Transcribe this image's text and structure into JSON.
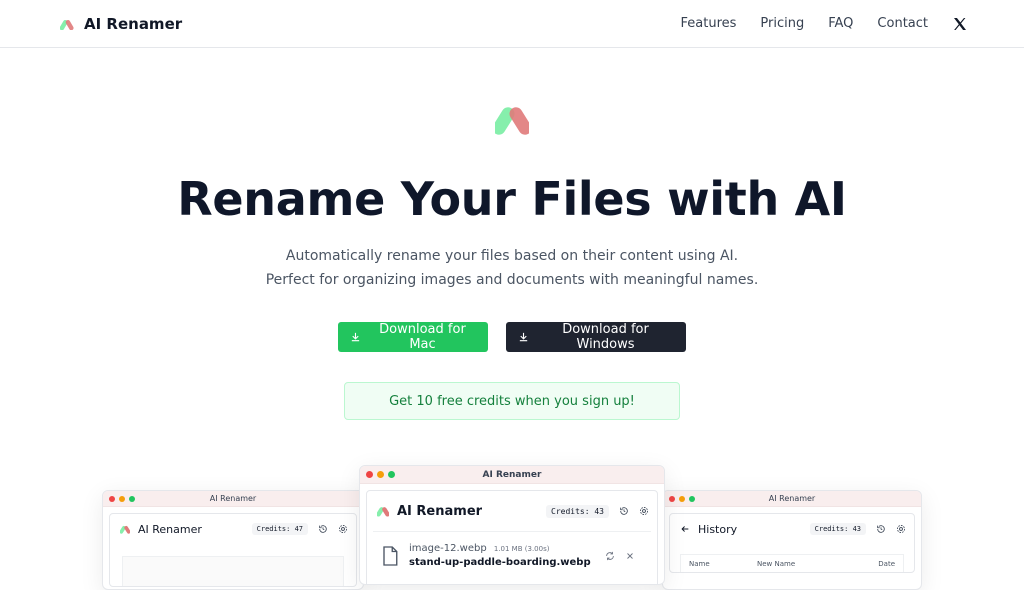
{
  "header": {
    "brand": "AI Renamer",
    "nav": [
      "Features",
      "Pricing",
      "FAQ",
      "Contact"
    ]
  },
  "hero": {
    "title": "Rename Your Files with AI",
    "subtitle": "Automatically rename your files based on their content using AI. Perfect for organizing images and documents with meaningful names.",
    "mac_button": "Download for Mac",
    "windows_button": "Download for Windows",
    "promo": "Get 10 free credits when you sign up!"
  },
  "colors": {
    "accent_green": "#22c55e",
    "dark_button": "#1f2430",
    "logo_green": "#86efac",
    "logo_red": "#e07a7a"
  },
  "icons": {
    "logo": "ai-renamer-logo-icon",
    "download": "download-icon",
    "history": "history-icon",
    "settings": "gear-icon",
    "file": "file-icon",
    "retry": "refresh-icon",
    "remove": "close-icon",
    "back": "arrow-left-icon",
    "social": "x-logo-icon"
  },
  "preview": {
    "left": {
      "window_title": "AI Renamer",
      "app_title": "AI Renamer",
      "credits": "Credits: 47"
    },
    "center": {
      "window_title": "AI Renamer",
      "app_title": "AI Renamer",
      "credits": "Credits: 43",
      "file": {
        "original": "image-12.webp",
        "meta": "1.01 MB (3.00s)",
        "renamed": "stand-up-paddle-boarding.webp"
      }
    },
    "right": {
      "window_title": "AI Renamer",
      "app_title": "History",
      "credits": "Credits: 43",
      "columns": [
        "Name",
        "New Name",
        "Date"
      ]
    }
  }
}
